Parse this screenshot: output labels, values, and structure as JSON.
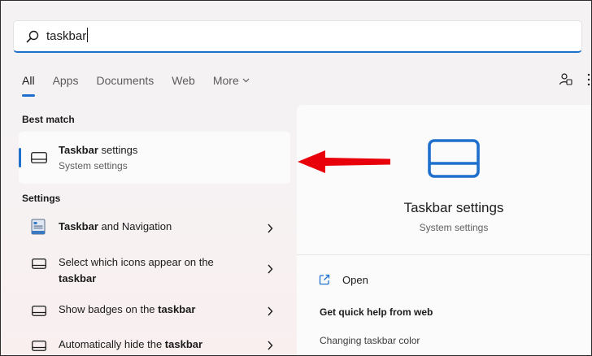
{
  "search": {
    "query": "taskbar"
  },
  "tabs": [
    {
      "label": "All",
      "active": true
    },
    {
      "label": "Apps"
    },
    {
      "label": "Documents"
    },
    {
      "label": "Web"
    },
    {
      "label": "More"
    }
  ],
  "best_match": {
    "heading": "Best match",
    "title_bold": "Taskbar",
    "title_rest": " settings",
    "subtitle": "System settings"
  },
  "settings_section": {
    "heading": "Settings",
    "items": [
      {
        "pre": "",
        "bold": "Taskbar",
        "post": " and Navigation",
        "icon": "taskbar-navigation-icon"
      },
      {
        "pre": "Select which icons appear on the ",
        "bold": "taskbar",
        "post": "",
        "icon": "taskbar-icon"
      },
      {
        "pre": "Show badges on the ",
        "bold": "taskbar",
        "post": "",
        "icon": "taskbar-icon"
      },
      {
        "pre": "Automatically hide the ",
        "bold": "taskbar",
        "post": "",
        "icon": "taskbar-icon"
      }
    ]
  },
  "detail": {
    "title": "Taskbar settings",
    "subtitle": "System settings",
    "open_label": "Open",
    "help_heading": "Get quick help from web",
    "help_link": "Changing taskbar color"
  },
  "colors": {
    "accent": "#1f6fcd",
    "annotation_arrow": "#e8000b"
  }
}
